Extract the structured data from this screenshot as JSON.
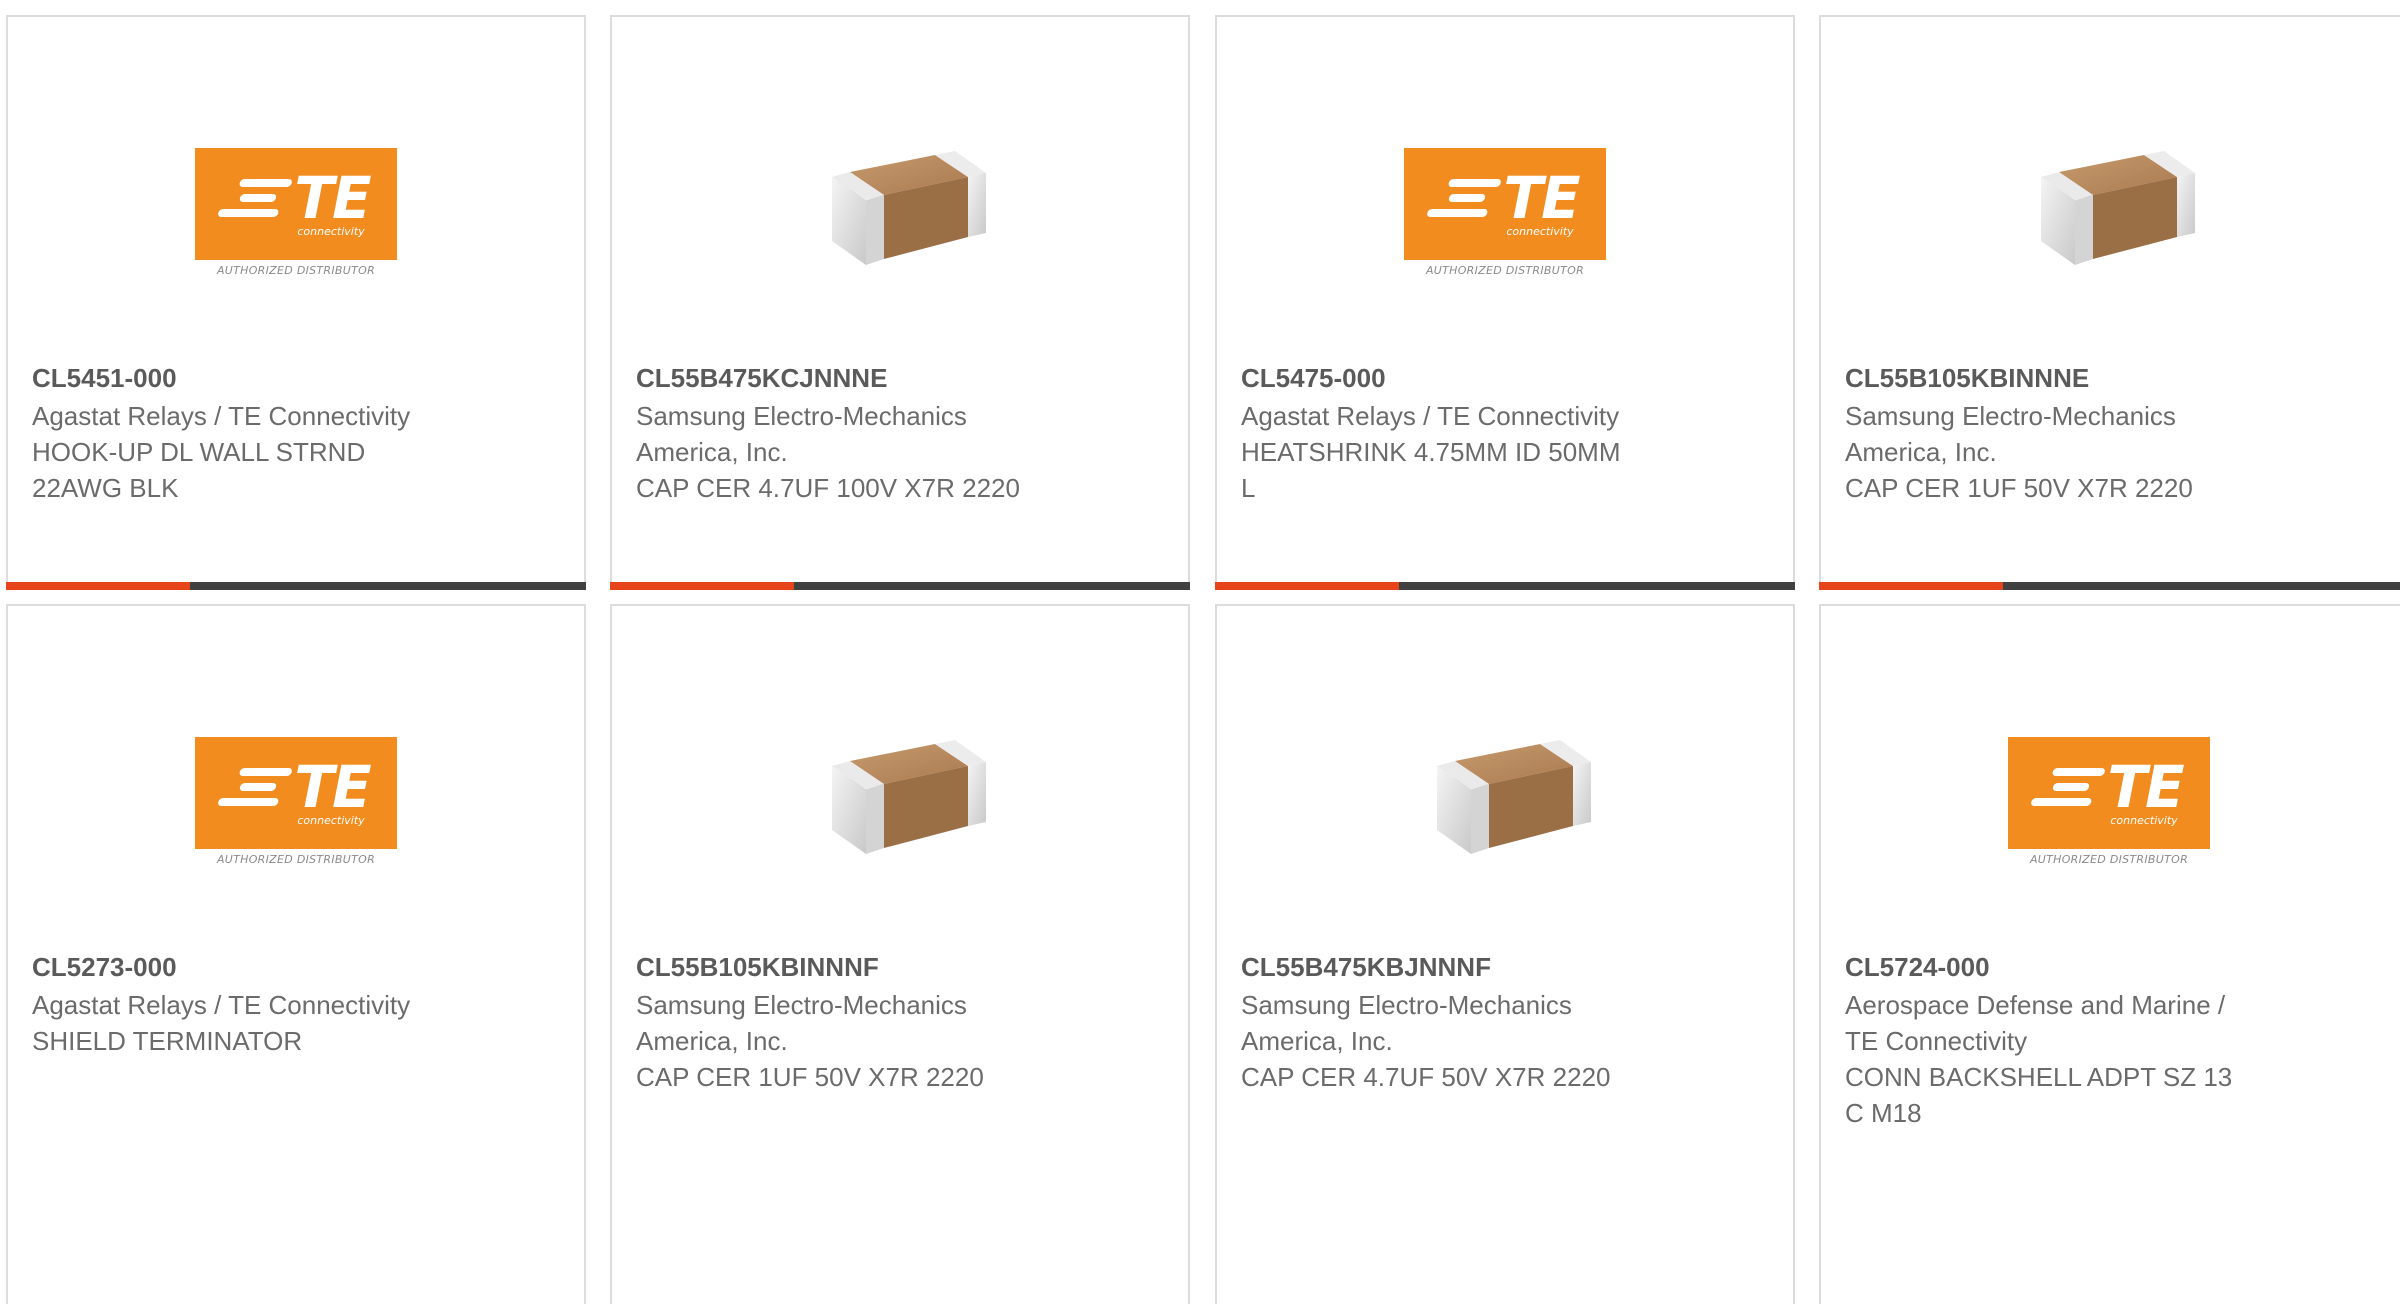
{
  "products": [
    {
      "part_number": "CL5451-000",
      "description_lines": [
        "Agastat Relays / TE Connectivity",
        "HOOK-UP DL WALL STRND",
        "22AWG BLK"
      ],
      "image": "te-logo-icon",
      "logo_text": "TE",
      "logo_sub": "connectivity",
      "logo_caption": "AUTHORIZED DISTRIBUTOR"
    },
    {
      "part_number": "CL55B475KCJNNNE",
      "description_lines": [
        "Samsung Electro-Mechanics",
        "America, Inc.",
        "CAP CER 4.7UF 100V X7R 2220"
      ],
      "image": "capacitor-icon"
    },
    {
      "part_number": "CL5475-000",
      "description_lines": [
        "Agastat Relays / TE Connectivity",
        "HEATSHRINK 4.75MM ID 50MM",
        "L"
      ],
      "image": "te-logo-icon",
      "logo_text": "TE",
      "logo_sub": "connectivity",
      "logo_caption": "AUTHORIZED DISTRIBUTOR"
    },
    {
      "part_number": "CL55B105KBINNNE",
      "description_lines": [
        "Samsung Electro-Mechanics",
        "America, Inc.",
        "CAP CER 1UF 50V X7R 2220"
      ],
      "image": "capacitor-icon"
    },
    {
      "part_number": "CL5273-000",
      "description_lines": [
        "Agastat Relays / TE Connectivity",
        "SHIELD TERMINATOR"
      ],
      "image": "te-logo-icon",
      "logo_text": "TE",
      "logo_sub": "connectivity",
      "logo_caption": "AUTHORIZED DISTRIBUTOR"
    },
    {
      "part_number": "CL55B105KBINNNF",
      "description_lines": [
        "Samsung Electro-Mechanics",
        "America, Inc.",
        "CAP CER 1UF 50V X7R 2220"
      ],
      "image": "capacitor-icon"
    },
    {
      "part_number": "CL55B475KBJNNNF",
      "description_lines": [
        "Samsung Electro-Mechanics",
        "America, Inc.",
        "CAP CER 4.7UF 50V X7R 2220"
      ],
      "image": "capacitor-icon"
    },
    {
      "part_number": "CL5724-000",
      "description_lines": [
        "Aerospace Defense and Marine /",
        "TE Connectivity",
        "CONN BACKSHELL ADPT SZ 13",
        "C M18"
      ],
      "image": "te-logo-icon",
      "logo_text": "TE",
      "logo_sub": "connectivity",
      "logo_caption": "AUTHORIZED DISTRIBUTOR"
    }
  ],
  "colors": {
    "accent_bar": "#e8441c",
    "base_bar": "#404040",
    "te_orange": "#f28c1e"
  }
}
